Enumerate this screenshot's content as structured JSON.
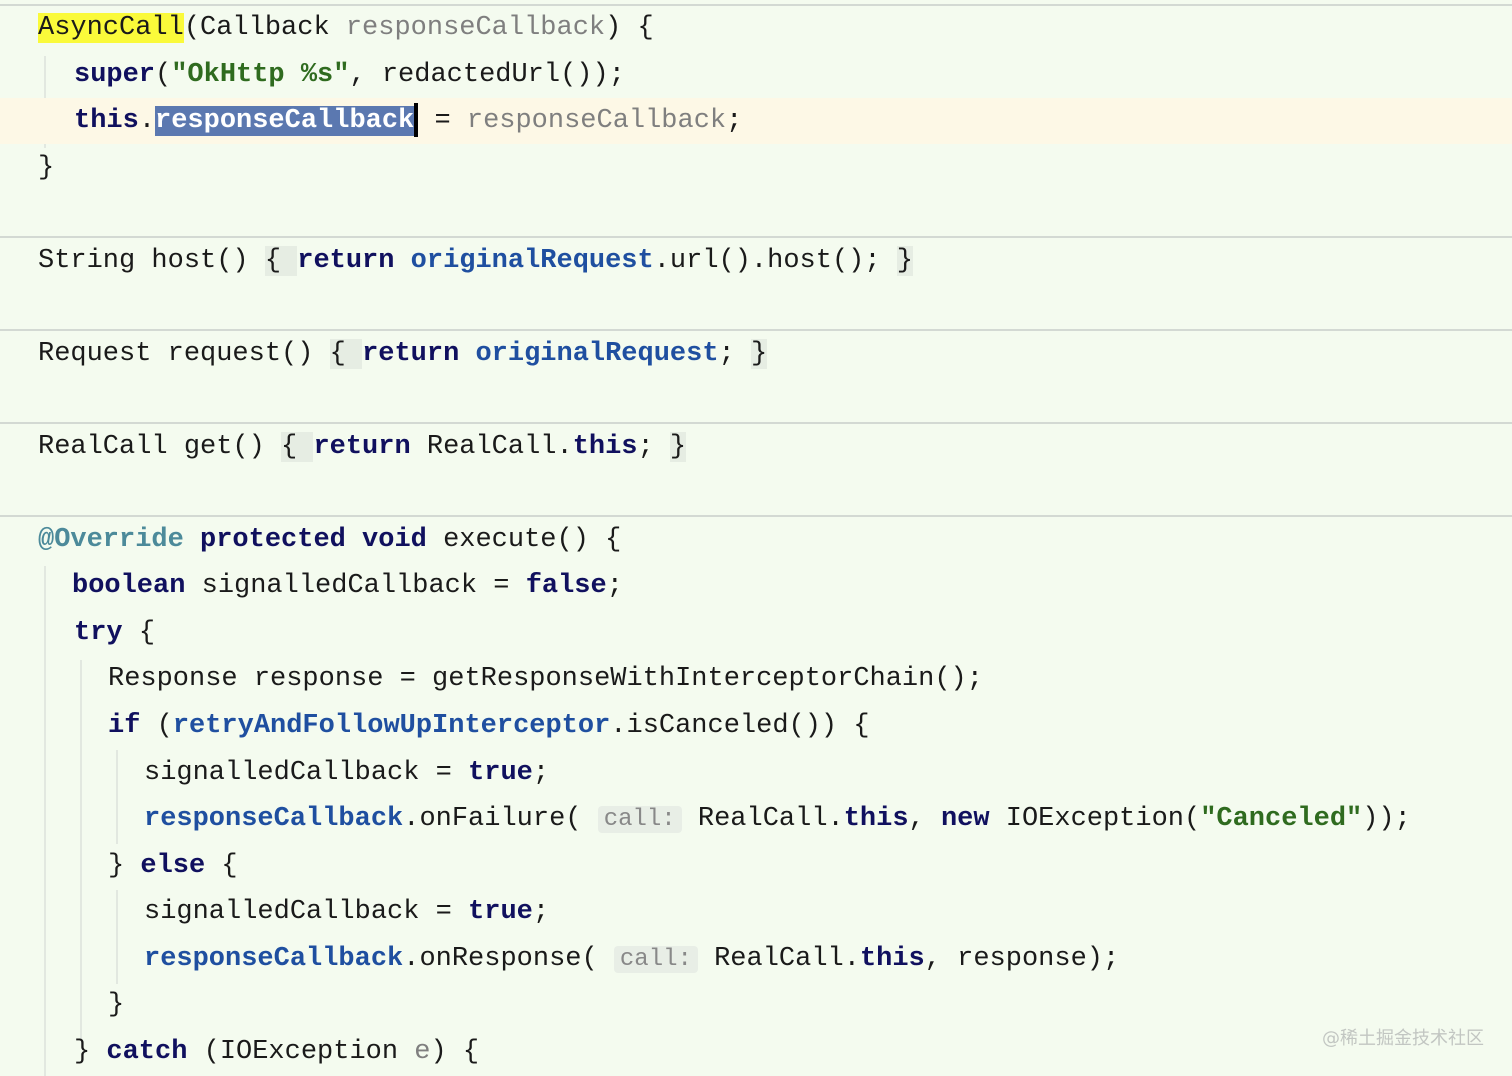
{
  "editor": {
    "lines": [
      {
        "tokens": [
          [
            "hl-yellow",
            "AsyncCall"
          ],
          [
            "plain",
            "(Callback "
          ],
          [
            "param",
            "responseCallback"
          ],
          [
            "plain",
            ") {"
          ]
        ]
      },
      {
        "tokens": [
          [
            "kw",
            "super"
          ],
          [
            "plain",
            "("
          ],
          [
            "str",
            "\"OkHttp %s\""
          ],
          [
            "plain",
            ", redactedUrl());"
          ]
        ]
      },
      {
        "tokens": [
          [
            "kw",
            "this"
          ],
          [
            "plain",
            "."
          ],
          [
            "sel",
            "responseCallback"
          ],
          [
            "caret",
            ""
          ],
          [
            "plain",
            " = "
          ],
          [
            "param",
            "responseCallback"
          ],
          [
            "plain",
            ";"
          ]
        ]
      },
      {
        "tokens": [
          [
            "plain",
            "}"
          ]
        ]
      },
      {
        "tokens": [
          [
            "plain",
            "String host() "
          ],
          [
            "fold",
            "{ "
          ],
          [
            "kw",
            "return "
          ],
          [
            "field",
            "originalRequest"
          ],
          [
            "plain",
            ".url().host(); "
          ],
          [
            "fold",
            "}"
          ]
        ]
      },
      {
        "tokens": [
          [
            "plain",
            "Request request() "
          ],
          [
            "fold",
            "{ "
          ],
          [
            "kw",
            "return "
          ],
          [
            "field",
            "originalRequest"
          ],
          [
            "plain",
            "; "
          ],
          [
            "fold",
            "}"
          ]
        ]
      },
      {
        "tokens": [
          [
            "plain",
            "RealCall get() "
          ],
          [
            "fold",
            "{ "
          ],
          [
            "kw",
            "return "
          ],
          [
            "plain",
            "RealCall."
          ],
          [
            "kw",
            "this"
          ],
          [
            "plain",
            "; "
          ],
          [
            "fold",
            "}"
          ]
        ]
      },
      {
        "tokens": [
          [
            "ann",
            "@Override "
          ],
          [
            "kw",
            "protected void "
          ],
          [
            "plain",
            "execute() {"
          ]
        ]
      },
      {
        "tokens": [
          [
            "kw",
            "boolean "
          ],
          [
            "plain",
            "signalledCallback = "
          ],
          [
            "kw",
            "false"
          ],
          [
            "plain",
            ";"
          ]
        ]
      },
      {
        "tokens": [
          [
            "kw",
            "try "
          ],
          [
            "plain",
            "{"
          ]
        ]
      },
      {
        "tokens": [
          [
            "plain",
            "Response response = getResponseWithInterceptorChain();"
          ]
        ]
      },
      {
        "tokens": [
          [
            "kw",
            "if "
          ],
          [
            "plain",
            "("
          ],
          [
            "field",
            "retryAndFollowUpInterceptor"
          ],
          [
            "plain",
            ".isCanceled()) {"
          ]
        ]
      },
      {
        "tokens": [
          [
            "plain",
            "signalledCallback = "
          ],
          [
            "kw",
            "true"
          ],
          [
            "plain",
            ";"
          ]
        ]
      },
      {
        "tokens": [
          [
            "field",
            "responseCallback"
          ],
          [
            "plain",
            ".onFailure( "
          ],
          [
            "hint",
            "call:"
          ],
          [
            "plain",
            " RealCall."
          ],
          [
            "kw",
            "this"
          ],
          [
            "plain",
            ", "
          ],
          [
            "kw",
            "new "
          ],
          [
            "plain",
            "IOException("
          ],
          [
            "str",
            "\"Canceled\""
          ],
          [
            "plain",
            "));"
          ]
        ]
      },
      {
        "tokens": [
          [
            "plain",
            "} "
          ],
          [
            "kw",
            "else "
          ],
          [
            "plain",
            "{"
          ]
        ]
      },
      {
        "tokens": [
          [
            "plain",
            "signalledCallback = "
          ],
          [
            "kw",
            "true"
          ],
          [
            "plain",
            ";"
          ]
        ]
      },
      {
        "tokens": [
          [
            "field",
            "responseCallback"
          ],
          [
            "plain",
            ".onResponse( "
          ],
          [
            "hint",
            "call:"
          ],
          [
            "plain",
            " RealCall."
          ],
          [
            "kw",
            "this"
          ],
          [
            "plain",
            ", response);"
          ]
        ]
      },
      {
        "tokens": [
          [
            "plain",
            "}"
          ]
        ]
      },
      {
        "tokens": [
          [
            "plain",
            "} "
          ],
          [
            "kw",
            "catch "
          ],
          [
            "plain",
            "(IOException "
          ],
          [
            "param",
            "e"
          ],
          [
            "plain",
            ") {"
          ]
        ]
      }
    ]
  },
  "watermark": "@稀土掘金技术社区"
}
